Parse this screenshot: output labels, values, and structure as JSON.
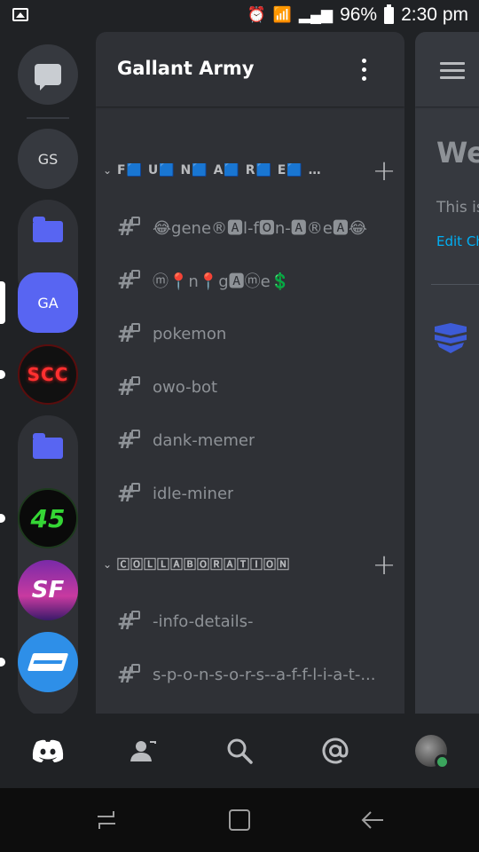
{
  "status_bar": {
    "battery": "96%",
    "time": "2:30 pm"
  },
  "servers": [
    {
      "label": "GS"
    },
    {
      "label": "GA"
    },
    {
      "label": "SCC"
    },
    {
      "label": "45"
    },
    {
      "label": "SF"
    }
  ],
  "server_name": "Gallant Army",
  "categories": [
    {
      "name": "F🟦 U🟦 N🟦 A🟦 R🟦 E🟦 …"
    },
    {
      "name": "🄲🄾🄻🄻🄰🄱🄾🅁🄰🅃🄸🄾🄽"
    }
  ],
  "channels": [
    {
      "name": "😂gene®🅰l-f🅾n-🅰®e🅰😂"
    },
    {
      "name": "ⓜ📍n📍g🅰ⓜe💲"
    },
    {
      "name": "pokemon"
    },
    {
      "name": "owo-bot"
    },
    {
      "name": "dank-memer"
    },
    {
      "name": "idle-miner"
    },
    {
      "name": "-info-details-"
    },
    {
      "name": "s-p-o-n-s-o-r-s--a-f-f-l-i-a-t-..."
    }
  ],
  "chat_preview": {
    "welcome": "We",
    "this_is": "This is",
    "edit_channel": "Edit Ch"
  },
  "colors": {
    "blurple": "#5865f2",
    "link": "#00aff4",
    "online": "#3ba55d"
  }
}
